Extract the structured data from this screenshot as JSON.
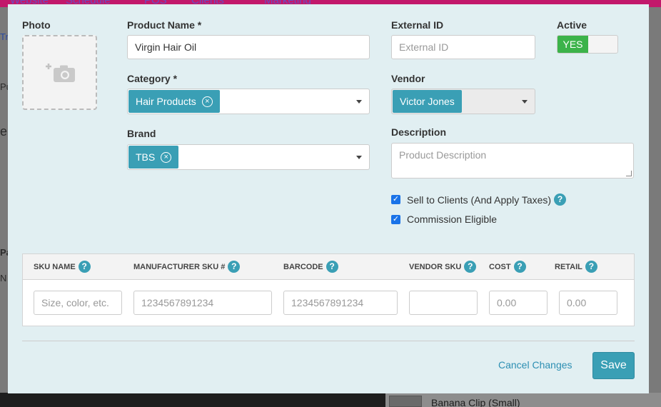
{
  "background": {
    "nav_items": [
      "Website",
      "Schedule",
      "POS",
      "Clients",
      "Marketing"
    ],
    "side_items": [
      "Tr",
      "Pu",
      "e",
      "Pa",
      "N"
    ],
    "list_item": "Banana Clip (Small)"
  },
  "modal": {
    "photo": {
      "label": "Photo",
      "icon": "add-camera-icon"
    },
    "product_name": {
      "label": "Product Name *",
      "value": "Virgin Hair Oil"
    },
    "external_id": {
      "label": "External ID",
      "placeholder": "External ID"
    },
    "active": {
      "label": "Active",
      "toggle_label": "YES",
      "state": "on"
    },
    "category": {
      "label": "Category *",
      "tag": "Hair Products"
    },
    "vendor": {
      "label": "Vendor",
      "tag": "Victor Jones"
    },
    "brand": {
      "label": "Brand",
      "tag": "TBS"
    },
    "description": {
      "label": "Description",
      "placeholder": "Product Description"
    },
    "checkboxes": [
      {
        "label": "Sell to Clients (And Apply Taxes)",
        "checked": true,
        "help": true
      },
      {
        "label": "Commission Eligible",
        "checked": true,
        "help": false
      }
    ],
    "sku_table": {
      "headers": [
        "SKU NAME",
        "MANUFACTURER SKU #",
        "BARCODE",
        "VENDOR SKU",
        "COST",
        "RETAIL"
      ],
      "placeholders": [
        "Size, color, etc.",
        "1234567891234",
        "1234567891234",
        "",
        "0.00",
        "0.00"
      ]
    },
    "cancel_label": "Cancel Changes",
    "save_label": "Save"
  },
  "colors": {
    "accent": "#3a9fb5",
    "toggle_on": "#3cb34a",
    "modal_bg": "#e1eff2"
  }
}
